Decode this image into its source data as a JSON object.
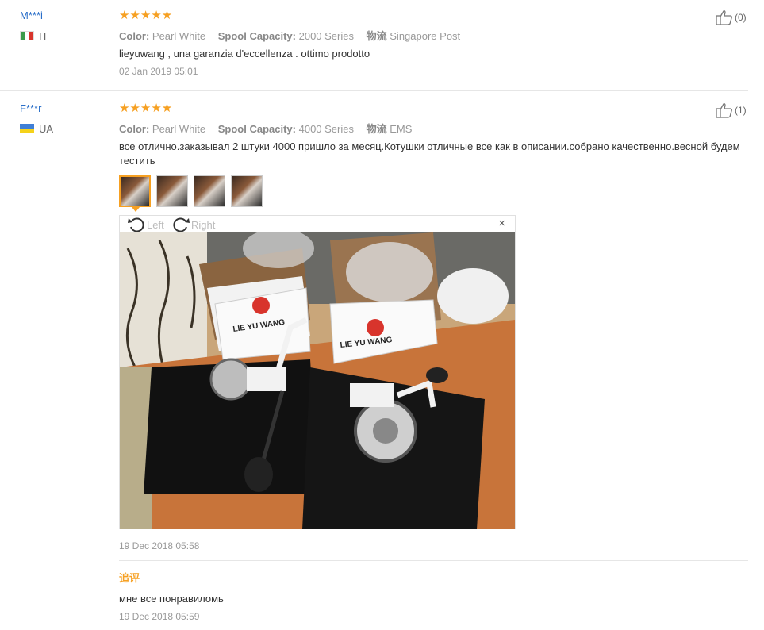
{
  "reviews": [
    {
      "user": "M***i",
      "country": "IT",
      "stars": "★★★★★",
      "color_label": "Color:",
      "color_value": "Pearl White",
      "spool_label": "Spool Capacity:",
      "spool_value": "2000 Series",
      "logistics_label": "物流",
      "logistics_value": "Singapore Post",
      "text": "lieyuwang , una garanzia d'eccellenza . ottimo prodotto",
      "date": "02 Jan 2019 05:01",
      "helpful": "(0)"
    },
    {
      "user": "F***r",
      "country": "UA",
      "stars": "★★★★★",
      "color_label": "Color:",
      "color_value": "Pearl White",
      "spool_label": "Spool Capacity:",
      "spool_value": "4000 Series",
      "logistics_label": "物流",
      "logistics_value": "EMS",
      "text": "все отлично.заказывал 2 штуки 4000 пришло за месяц.Котушки отличные все как в описании.собрано качественно.весной будем тестить",
      "date": "19 Dec 2018 05:58",
      "helpful": "(1)",
      "viewer": {
        "rotate_left": "Left",
        "rotate_right": "Right",
        "close": "×",
        "box_brand": "LIE YU WANG"
      },
      "followup": {
        "label": "追评",
        "text": "мне все понравиломь",
        "date": "19 Dec 2018 05:59"
      }
    }
  ],
  "colors": {
    "accent": "#f6a022",
    "username": "#2a6fc9",
    "muted": "#999999"
  }
}
